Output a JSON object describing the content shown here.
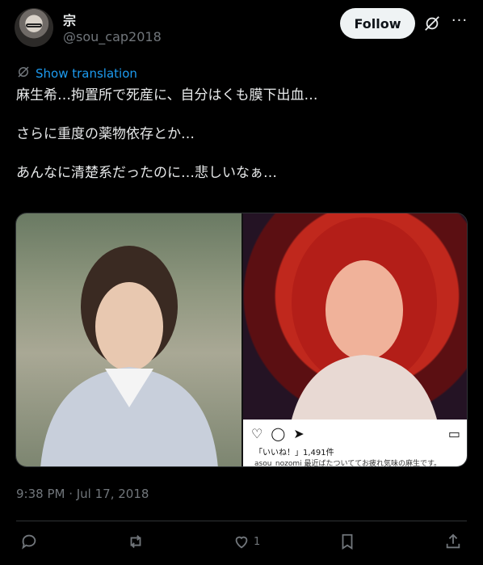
{
  "author": {
    "display_name": "宗",
    "handle": "@sou_cap2018"
  },
  "header": {
    "follow_label": "Follow",
    "more_label": "···"
  },
  "translation": {
    "label": "Show translation"
  },
  "tweet": {
    "lines": [
      "麻生希…拘置所で死産に、自分はくも膜下出血…",
      "さらに重度の薬物依存とか…",
      "あんなに清楚系だったのに…悲しいなぁ…"
    ],
    "timestamp": "9:38 PM · Jul 17, 2018"
  },
  "media": {
    "instagram": {
      "likes": "「いいね！」1,491件",
      "caption": "asou_nozomi 最近ばたついててお疲れ気味の麻生です。"
    }
  },
  "actions": {
    "reply_count": "",
    "retweet_count": "",
    "like_count": "1"
  },
  "colors": {
    "background": "#000000",
    "accent": "#1d9bf0",
    "secondary_text": "#71767b"
  }
}
